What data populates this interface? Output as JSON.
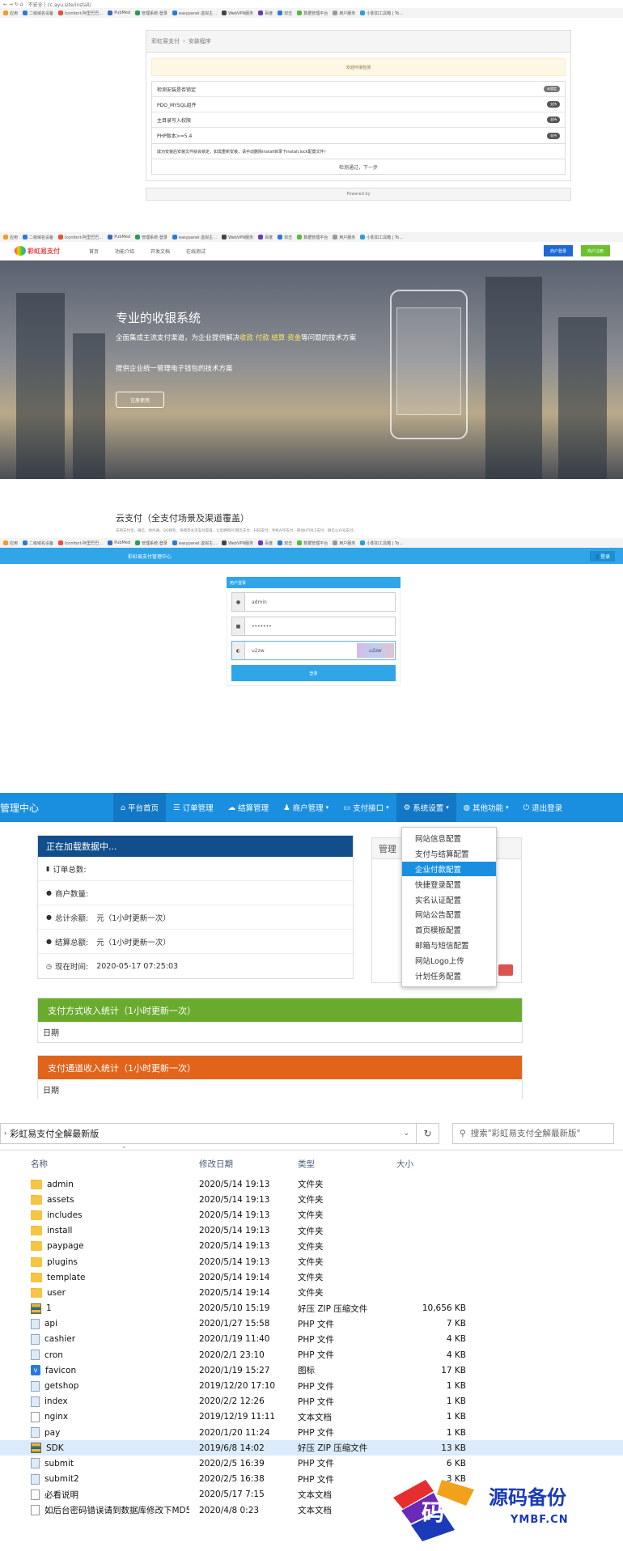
{
  "bookmarks": [
    "应用",
    "二级域名设备",
    "Iconfont-阿里巴巴…",
    "PubMed",
    "管理系统-登录",
    "easypanel 虚拟主…",
    "WebVPN服务",
    "百度",
    "双击",
    "数据管理平台",
    "用户服务",
    "小影扣工具箱 | To…"
  ],
  "install": {
    "address": "不安全 | cc.ayu.site/install/",
    "breadcrumb_root": "彩虹易支付",
    "breadcrumb_sep": "›",
    "breadcrumb_page": "安装程序",
    "alert": "欢迎环境检测",
    "checks": [
      {
        "label": "检测安装是否锁定",
        "badge": "未锁定"
      },
      {
        "label": "PDO_MYSQL组件",
        "badge": "支持"
      },
      {
        "label": "主目录写入权限",
        "badge": "支持"
      },
      {
        "label": "PHP版本>=5.4",
        "badge": "支持"
      }
    ],
    "notice": "成功安装后安装文件就会锁定，如需重新安装，请手动删除install目录下install.lock配置文件！",
    "next": "检测通过，下一步",
    "powered": "Powered by"
  },
  "home": {
    "logo": "彩虹易支付",
    "nav": [
      "首页",
      "功能介绍",
      "开发文档",
      "在线测试"
    ],
    "login_btn": "商户登录",
    "register_btn": "商户注册",
    "hero_title": "专业的收银系统",
    "hero_sub_a": "全面集成主流支付渠道，为企业提供解决",
    "hero_sub_b": "收款 付款 结算 资金",
    "hero_sub_c": "等问题的技术方案",
    "hero_sub2": "提供企业统一管理电子钱包的技术方案",
    "hero_btn": "注册使用",
    "section_title": "云支付（全支付场景及渠道覆盖）",
    "section_text": "支持支付宝、微信、财付通、QQ钱包、快钱等主流支付渠道，让您拥有PC网页支付、扫码支付、手机APP支付、移动HTML5支付、微信公众号支付。"
  },
  "login": {
    "bar_title": "彩虹易支付管理中心",
    "bar_user": "登录",
    "box_title": "用户登录",
    "username": "admin",
    "password": "•••••••",
    "captcha_input": "u2zw",
    "captcha_img": "u2zw",
    "submit": "登录"
  },
  "admin": {
    "brand": "管理中心",
    "nav": [
      "平台首页",
      "订单管理",
      "结算管理",
      "商户管理",
      "支付接口",
      "系统设置",
      "其他功能",
      "退出登录"
    ],
    "loading": "正在加载数据中...",
    "stats": [
      {
        "label": "订单总数:",
        "value": ""
      },
      {
        "label": "商户数量:",
        "value": ""
      },
      {
        "label": "总计余额:",
        "value": "元（1小时更新一次）"
      },
      {
        "label": "结算总额:",
        "value": "元（1小时更新一次）"
      },
      {
        "label": "现在时间:",
        "value": "2020-05-17 07:25:03"
      }
    ],
    "side_title": "管理",
    "dropdown": [
      "网站信息配置",
      "支付与结算配置",
      "企业付款配置",
      "快捷登录配置",
      "实名认证配置",
      "网站公告配置",
      "首页模板配置",
      "邮箱与短信配置",
      "网站Logo上传",
      "计划任务配置"
    ],
    "dropdown_selected": 2,
    "card1_title": "支付方式收入统计（1小时更新一次）",
    "card1_row": "日期",
    "card2_title": "支付通道收入统计（1小时更新一次）",
    "card2_row": "日期",
    "colors": {
      "nav": "#1a8fe0",
      "dark_head": "#124e8c",
      "green": "#6aab2e",
      "orange": "#e2631a"
    }
  },
  "explorer": {
    "path": "彩虹易支付全解最新版",
    "search_placeholder": "搜索\"彩虹易支付全解最新版\"",
    "columns": [
      "名称",
      "修改日期",
      "类型",
      "大小"
    ],
    "files": [
      {
        "name": "admin",
        "date": "2020/5/14 19:13",
        "type": "文件夹",
        "size": "",
        "icon": "folder"
      },
      {
        "name": "assets",
        "date": "2020/5/14 19:13",
        "type": "文件夹",
        "size": "",
        "icon": "folder"
      },
      {
        "name": "includes",
        "date": "2020/5/14 19:13",
        "type": "文件夹",
        "size": "",
        "icon": "folder"
      },
      {
        "name": "install",
        "date": "2020/5/14 19:13",
        "type": "文件夹",
        "size": "",
        "icon": "folder"
      },
      {
        "name": "paypage",
        "date": "2020/5/14 19:13",
        "type": "文件夹",
        "size": "",
        "icon": "folder"
      },
      {
        "name": "plugins",
        "date": "2020/5/14 19:13",
        "type": "文件夹",
        "size": "",
        "icon": "folder"
      },
      {
        "name": "template",
        "date": "2020/5/14 19:14",
        "type": "文件夹",
        "size": "",
        "icon": "folder"
      },
      {
        "name": "user",
        "date": "2020/5/14 19:14",
        "type": "文件夹",
        "size": "",
        "icon": "folder"
      },
      {
        "name": "1",
        "date": "2020/5/10 15:19",
        "type": "好压 ZIP 压缩文件",
        "size": "10,656 KB",
        "icon": "zip"
      },
      {
        "name": "api",
        "date": "2020/1/27 15:58",
        "type": "PHP 文件",
        "size": "7 KB",
        "icon": "php"
      },
      {
        "name": "cashier",
        "date": "2020/1/19 11:40",
        "type": "PHP 文件",
        "size": "4 KB",
        "icon": "php"
      },
      {
        "name": "cron",
        "date": "2020/2/1 23:10",
        "type": "PHP 文件",
        "size": "4 KB",
        "icon": "php"
      },
      {
        "name": "favicon",
        "date": "2020/1/19 15:27",
        "type": "图标",
        "size": "17 KB",
        "icon": "ico"
      },
      {
        "name": "getshop",
        "date": "2019/12/20 17:10",
        "type": "PHP 文件",
        "size": "1 KB",
        "icon": "php"
      },
      {
        "name": "index",
        "date": "2020/2/2 12:26",
        "type": "PHP 文件",
        "size": "1 KB",
        "icon": "php"
      },
      {
        "name": "nginx",
        "date": "2019/12/19 11:11",
        "type": "文本文档",
        "size": "1 KB",
        "icon": "txt"
      },
      {
        "name": "pay",
        "date": "2020/1/20 11:24",
        "type": "PHP 文件",
        "size": "1 KB",
        "icon": "php"
      },
      {
        "name": "SDK",
        "date": "2019/6/8 14:02",
        "type": "好压 ZIP 压缩文件",
        "size": "13 KB",
        "icon": "zip"
      },
      {
        "name": "submit",
        "date": "2020/2/5 16:39",
        "type": "PHP 文件",
        "size": "6 KB",
        "icon": "php"
      },
      {
        "name": "submit2",
        "date": "2020/2/5 16:38",
        "type": "PHP 文件",
        "size": "3 KB",
        "icon": "php"
      },
      {
        "name": "必看说明",
        "date": "2020/5/17 7:15",
        "type": "文本文档",
        "size": "",
        "icon": "txt"
      },
      {
        "name": "如后台密码错误请到数据库修改下MD5",
        "date": "2020/4/8 0:23",
        "type": "文本文档",
        "size": "",
        "icon": "txt"
      }
    ],
    "selected_index": 17
  },
  "watermark": {
    "text": "源码备份",
    "url": "YMBF.CN",
    "glyph": "码"
  }
}
